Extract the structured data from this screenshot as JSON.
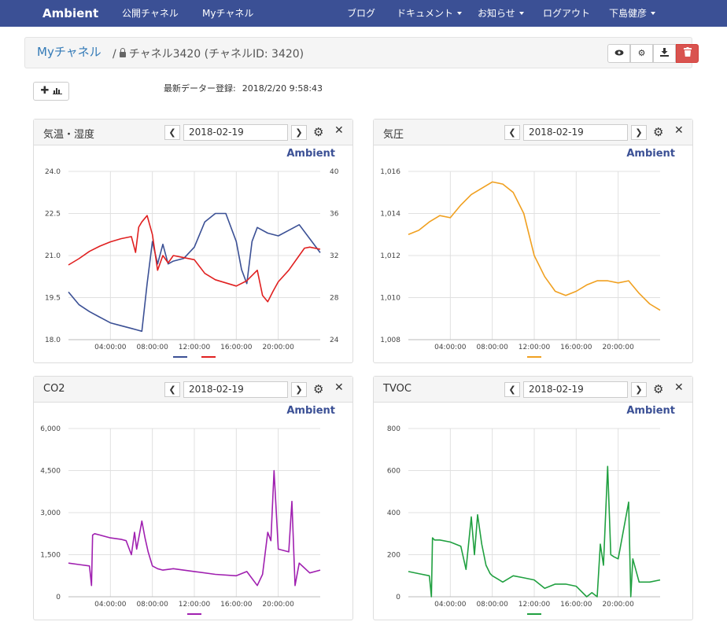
{
  "nav": {
    "brand": "Ambient",
    "public_channels": "公開チャネル",
    "my_channels": "Myチャネル",
    "blog": "ブログ",
    "docs": "ドキュメント",
    "news": "お知らせ",
    "logout": "ログアウト",
    "user": "下島健彦"
  },
  "breadcrumb": {
    "link": "Myチャネル",
    "separator": "/",
    "channel": "チャネル3420 (チャネルID: 3420)"
  },
  "toolbar_icons": [
    "eye-icon",
    "gear-icon",
    "download-icon",
    "trash-icon"
  ],
  "latest": {
    "label": "最新データー登録:",
    "value": "2018/2/20 9:58:43"
  },
  "brandmark": "Ambient",
  "colors": {
    "navbar": "#3b5095",
    "temp": "#3b5095",
    "humid": "#e02020",
    "pressure": "#f0a020",
    "co2": "#a020b0",
    "tvoc": "#20a040"
  },
  "panels": [
    {
      "title": "気温・湿度",
      "date": "2018-02-19"
    },
    {
      "title": "気圧",
      "date": "2018-02-19"
    },
    {
      "title": "CO2",
      "date": "2018-02-19"
    },
    {
      "title": "TVOC",
      "date": "2018-02-19"
    }
  ],
  "chart_data": [
    {
      "type": "line",
      "title": "気温・湿度",
      "x_ticks": [
        "04:00:00",
        "08:00:00",
        "12:00:00",
        "16:00:00",
        "20:00:00"
      ],
      "xlim": [
        0,
        24
      ],
      "y_ticks": [
        "18.0",
        "19.5",
        "21.0",
        "22.5",
        "24.0"
      ],
      "ylim": [
        18.0,
        24.0
      ],
      "y2_ticks": [
        "24",
        "28",
        "32",
        "36",
        "40"
      ],
      "y2lim": [
        24,
        40
      ],
      "grid": true,
      "legend": "bottom",
      "series": [
        {
          "axis": "left",
          "color": "#3b5095",
          "x": [
            0,
            1,
            2,
            3,
            4,
            5,
            6,
            6.5,
            7,
            7.5,
            8,
            8.5,
            9,
            9.5,
            10,
            11,
            12,
            13,
            14,
            15,
            16,
            16.5,
            17,
            17.5,
            18,
            19,
            20,
            21,
            22,
            23,
            24
          ],
          "y": [
            19.7,
            19.25,
            19.0,
            18.8,
            18.6,
            18.5,
            18.4,
            18.35,
            18.3,
            20.0,
            21.5,
            20.7,
            21.4,
            20.7,
            20.8,
            20.9,
            21.3,
            22.2,
            22.5,
            22.5,
            21.5,
            20.5,
            20.0,
            21.5,
            22.0,
            21.8,
            21.7,
            21.9,
            22.1,
            21.6,
            21.1
          ]
        },
        {
          "axis": "right",
          "color": "#e02020",
          "x": [
            0,
            1,
            2,
            3,
            4,
            5,
            6,
            6.4,
            6.7,
            7,
            7.5,
            8,
            8.5,
            9,
            9.5,
            10,
            11,
            12,
            13,
            14,
            15,
            16,
            17,
            18,
            18.5,
            19,
            19.5,
            20,
            21,
            22,
            22.5,
            23,
            24
          ],
          "y": [
            31.1,
            31.7,
            32.4,
            32.9,
            33.3,
            33.6,
            33.8,
            32.3,
            34.7,
            35.2,
            35.8,
            34.0,
            30.6,
            32.0,
            31.3,
            32.0,
            31.8,
            31.6,
            30.3,
            29.7,
            29.4,
            29.1,
            29.6,
            30.6,
            28.2,
            27.6,
            28.6,
            29.5,
            30.6,
            32.0,
            32.7,
            32.8,
            32.6
          ]
        }
      ]
    },
    {
      "type": "line",
      "title": "気圧",
      "x_ticks": [
        "04:00:00",
        "08:00:00",
        "12:00:00",
        "16:00:00",
        "20:00:00"
      ],
      "xlim": [
        0,
        24
      ],
      "y_ticks": [
        "1,008",
        "1,010",
        "1,012",
        "1,014",
        "1,016"
      ],
      "ylim": [
        1008,
        1016
      ],
      "grid": true,
      "legend": "bottom",
      "series": [
        {
          "axis": "left",
          "color": "#f0a020",
          "x": [
            0,
            1,
            2,
            3,
            4,
            5,
            6,
            7,
            8,
            9,
            10,
            11,
            12,
            13,
            14,
            15,
            16,
            17,
            18,
            19,
            20,
            21,
            22,
            23,
            24
          ],
          "y": [
            1013.0,
            1013.2,
            1013.6,
            1013.9,
            1013.8,
            1014.4,
            1014.9,
            1015.2,
            1015.5,
            1015.4,
            1015.0,
            1014.0,
            1012.0,
            1011.0,
            1010.3,
            1010.1,
            1010.3,
            1010.6,
            1010.8,
            1010.8,
            1010.7,
            1010.8,
            1010.2,
            1009.7,
            1009.4
          ]
        }
      ]
    },
    {
      "type": "line",
      "title": "CO2",
      "x_ticks": [
        "04:00:00",
        "08:00:00",
        "12:00:00",
        "16:00:00",
        "20:00:00"
      ],
      "xlim": [
        0,
        24
      ],
      "y_ticks": [
        "0",
        "1,500",
        "3,000",
        "4,500",
        "6,000"
      ],
      "ylim": [
        0,
        6000
      ],
      "grid": true,
      "legend": "bottom",
      "series": [
        {
          "axis": "left",
          "color": "#a020b0",
          "x": [
            0,
            1,
            2,
            2.2,
            2.3,
            2.5,
            3,
            4,
            5,
            5.5,
            6,
            6.3,
            6.5,
            6.8,
            7,
            7.3,
            7.6,
            8,
            8.5,
            9,
            10,
            12,
            14,
            16,
            17,
            18,
            18.5,
            19,
            19.3,
            19.6,
            20,
            21,
            21.3,
            21.6,
            22,
            23,
            24
          ],
          "y": [
            1200,
            1150,
            1100,
            400,
            2200,
            2250,
            2200,
            2100,
            2050,
            2000,
            1500,
            2300,
            1700,
            2300,
            2700,
            2100,
            1600,
            1100,
            1000,
            950,
            1000,
            900,
            800,
            750,
            900,
            400,
            800,
            2300,
            2000,
            4500,
            1700,
            1600,
            3400,
            400,
            1200,
            850,
            950
          ]
        }
      ]
    },
    {
      "type": "line",
      "title": "TVOC",
      "x_ticks": [
        "04:00:00",
        "08:00:00",
        "12:00:00",
        "16:00:00",
        "20:00:00"
      ],
      "xlim": [
        0,
        24
      ],
      "y_ticks": [
        "0",
        "200",
        "400",
        "600",
        "800"
      ],
      "ylim": [
        0,
        800
      ],
      "grid": true,
      "legend": "bottom",
      "series": [
        {
          "axis": "left",
          "color": "#20a040",
          "x": [
            0,
            1,
            2,
            2.2,
            2.3,
            2.5,
            3,
            4,
            5,
            5.5,
            6,
            6.3,
            6.6,
            7,
            7.4,
            7.8,
            8,
            9,
            10,
            11,
            12,
            13,
            14,
            15,
            16,
            17,
            17.5,
            18,
            18.3,
            18.6,
            19,
            19.3,
            19.6,
            20,
            21,
            21.2,
            21.4,
            22,
            23,
            24
          ],
          "y": [
            120,
            110,
            100,
            0,
            280,
            270,
            270,
            260,
            240,
            130,
            380,
            200,
            390,
            250,
            150,
            110,
            100,
            70,
            100,
            90,
            80,
            40,
            60,
            60,
            50,
            0,
            20,
            0,
            250,
            150,
            620,
            200,
            190,
            180,
            450,
            0,
            180,
            70,
            70,
            80
          ]
        }
      ]
    }
  ]
}
